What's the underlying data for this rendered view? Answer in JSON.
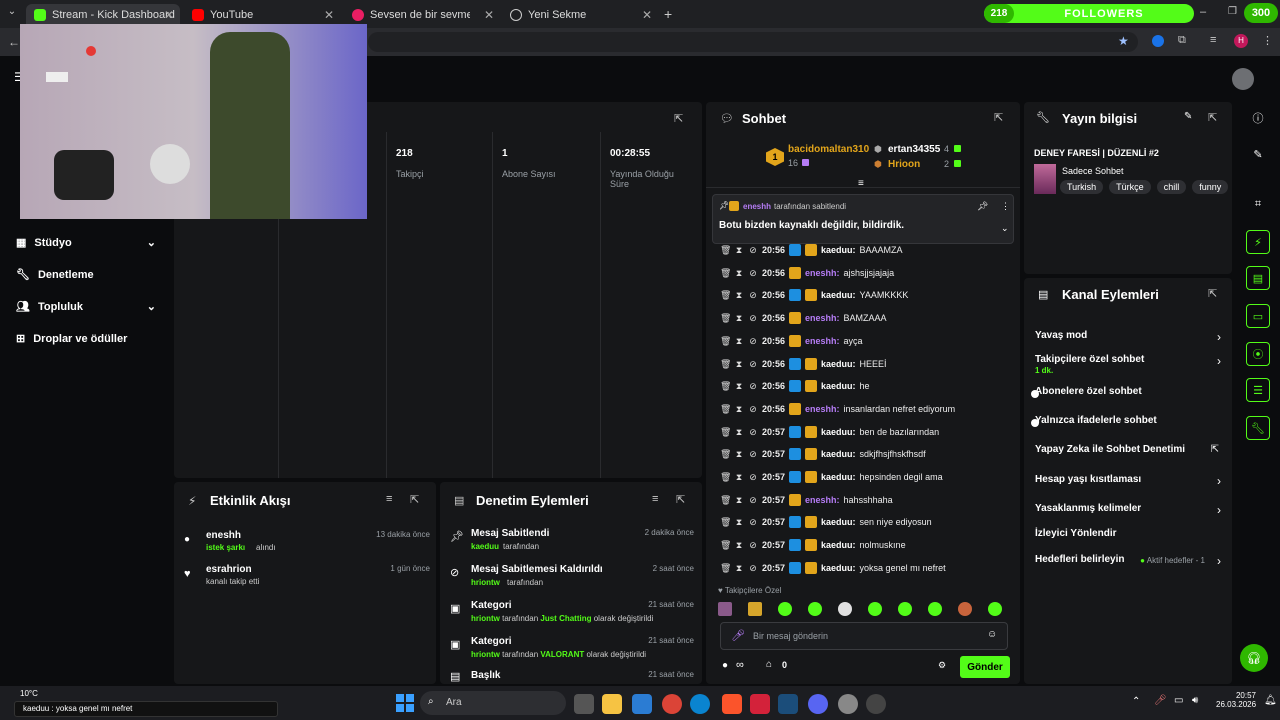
{
  "tabs": [
    {
      "label": "Stream - Kick Dashboard",
      "color": "#53fc18"
    },
    {
      "label": "YouTube",
      "color": "#ff0000"
    },
    {
      "label": "Sevsen de bir sevmesen de",
      "color": "#e91e63"
    },
    {
      "label": "Yeni Sekme",
      "color": "#cccccc"
    }
  ],
  "followers_widget": {
    "count": "218",
    "label": "FOLLOWERS",
    "right_count": "300"
  },
  "profile_initial": "H",
  "sidebar": {
    "items": [
      {
        "label": "Stüdyo"
      },
      {
        "label": "Denetleme"
      },
      {
        "label": "Topluluk"
      },
      {
        "label": "Droplar ve ödüller"
      }
    ]
  },
  "stats": [
    {
      "value": "218",
      "label": "Takipçi"
    },
    {
      "value": "1",
      "label": "Abone Sayısı"
    },
    {
      "value": "00:28:55",
      "label": "Yayında Olduğu Süre"
    }
  ],
  "activity": {
    "title": "Etkinlik Akışı",
    "items": [
      {
        "user": "eneshh",
        "action": "istek şarkı",
        "suffix": "alındı",
        "time": "13 dakika önce"
      },
      {
        "user": "esrahrion",
        "action": "",
        "suffix": "kanalı takip etti",
        "time": "1 gün önce"
      }
    ]
  },
  "moderation": {
    "title": "Denetim Eylemleri",
    "items": [
      {
        "title": "Mesaj Sabitlendi",
        "user": "kaeduu",
        "detail": "tarafından",
        "time": "2 dakika önce"
      },
      {
        "title": "Mesaj Sabitlemesi Kaldırıldı",
        "user": "hriontw",
        "detail": "tarafından",
        "time": "2 saat önce"
      },
      {
        "title": "Kategori",
        "user": "hriontw",
        "detail": "tarafından",
        "value": "Just Chatting",
        "tail": "olarak değiştirildi",
        "time": "21 saat önce"
      },
      {
        "title": "Kategori",
        "user": "hriontw",
        "detail": "tarafından",
        "value": "VALORANT",
        "tail": "olarak değiştirildi",
        "time": "21 saat önce"
      },
      {
        "title": "Başlık",
        "user": "",
        "detail": "",
        "time": "21 saat önce"
      }
    ]
  },
  "chat": {
    "title": "Sohbet",
    "leaderboard": [
      {
        "rank": "1",
        "name": "bacidomaltan310",
        "count": "16"
      },
      {
        "rank": "",
        "name": "ertan34355",
        "count": "4"
      },
      {
        "rank": "",
        "name": "Hrioon",
        "count": "2"
      }
    ],
    "pinned": {
      "user": "eneshh",
      "by": "tarafından sabitlendi",
      "text": "Botu bizden kaynaklı değildir, bildirdik."
    },
    "messages": [
      {
        "time": "20:56",
        "user": "kaeduu",
        "text": "BAAAMZA",
        "mod": true
      },
      {
        "time": "20:56",
        "user": "eneshh",
        "text": "ajshsjjsjajaja",
        "mod": false
      },
      {
        "time": "20:56",
        "user": "kaeduu",
        "text": "YAAMKKKK",
        "mod": true
      },
      {
        "time": "20:56",
        "user": "eneshh",
        "text": "BAMZAAA",
        "mod": false
      },
      {
        "time": "20:56",
        "user": "eneshh",
        "text": "ayça",
        "mod": false
      },
      {
        "time": "20:56",
        "user": "kaeduu",
        "text": "HEEEİ",
        "mod": true
      },
      {
        "time": "20:56",
        "user": "kaeduu",
        "text": "he",
        "mod": true
      },
      {
        "time": "20:56",
        "user": "eneshh",
        "text": "insanlardan nefret ediyorum",
        "mod": false
      },
      {
        "time": "20:57",
        "user": "kaeduu",
        "text": "ben de bazılarından",
        "mod": true
      },
      {
        "time": "20:57",
        "user": "kaeduu",
        "text": "sdkjfhsjfhskfhsdf",
        "mod": true
      },
      {
        "time": "20:57",
        "user": "kaeduu",
        "text": "hepsinden degil ama",
        "mod": true
      },
      {
        "time": "20:57",
        "user": "eneshh",
        "text": "hahsshhaha",
        "mod": false
      },
      {
        "time": "20:57",
        "user": "kaeduu",
        "text": "sen niye ediyosun",
        "mod": true
      },
      {
        "time": "20:57",
        "user": "kaeduu",
        "text": "nolmuskıne",
        "mod": true
      },
      {
        "time": "20:57",
        "user": "kaeduu",
        "text": "yoksa genel mı nefret",
        "mod": true
      }
    ],
    "followers_only_label": "Takipçilere Özel",
    "input_placeholder": "Bir mesaj gönderin",
    "points": "∞",
    "store_count": "0",
    "send_label": "Gönder"
  },
  "stream_info": {
    "title": "Yayın bilgisi",
    "stream_title": "DENEY FARESİ | DÜZENLİ #2",
    "category": "Sadece Sohbet",
    "tags": [
      "Turkish",
      "Türkçe",
      "chill",
      "funny"
    ]
  },
  "channel_actions": {
    "title": "Kanal Eylemleri",
    "items": [
      {
        "label": "Yavaş mod",
        "sub": "",
        "type": "chevron"
      },
      {
        "label": "Takipçilere özel sohbet",
        "sub": "1 dk.",
        "type": "chevron"
      },
      {
        "label": "Abonelere özel sohbet",
        "sub": "",
        "type": "toggle"
      },
      {
        "label": "Yalnızca ifadelerle sohbet",
        "sub": "",
        "type": "toggle"
      },
      {
        "label": "Yapay Zeka ile Sohbet Denetimi",
        "sub": "",
        "type": "external"
      },
      {
        "label": "Hesap yaşı kısıtlaması",
        "sub": "",
        "type": "chevron"
      },
      {
        "label": "Yasaklanmış kelimeler",
        "sub": "",
        "type": "chevron"
      },
      {
        "label": "İzleyici Yönlendir",
        "sub": "",
        "type": "none"
      },
      {
        "label": "Hedefleri belirleyin",
        "sub": "Aktif hedefler - 1",
        "type": "chevron"
      }
    ]
  },
  "taskbar": {
    "weather": "10°C",
    "notification": "kaeduu : yoksa genel mı nefret",
    "search_label": "Ara",
    "time": "20:57",
    "date": "26.03.2026"
  },
  "colors": {
    "accent": "#53fc18",
    "panel": "#161719",
    "bg": "#0b0c0e",
    "crown": "#e2a51b",
    "purple": "#b57cf5"
  }
}
